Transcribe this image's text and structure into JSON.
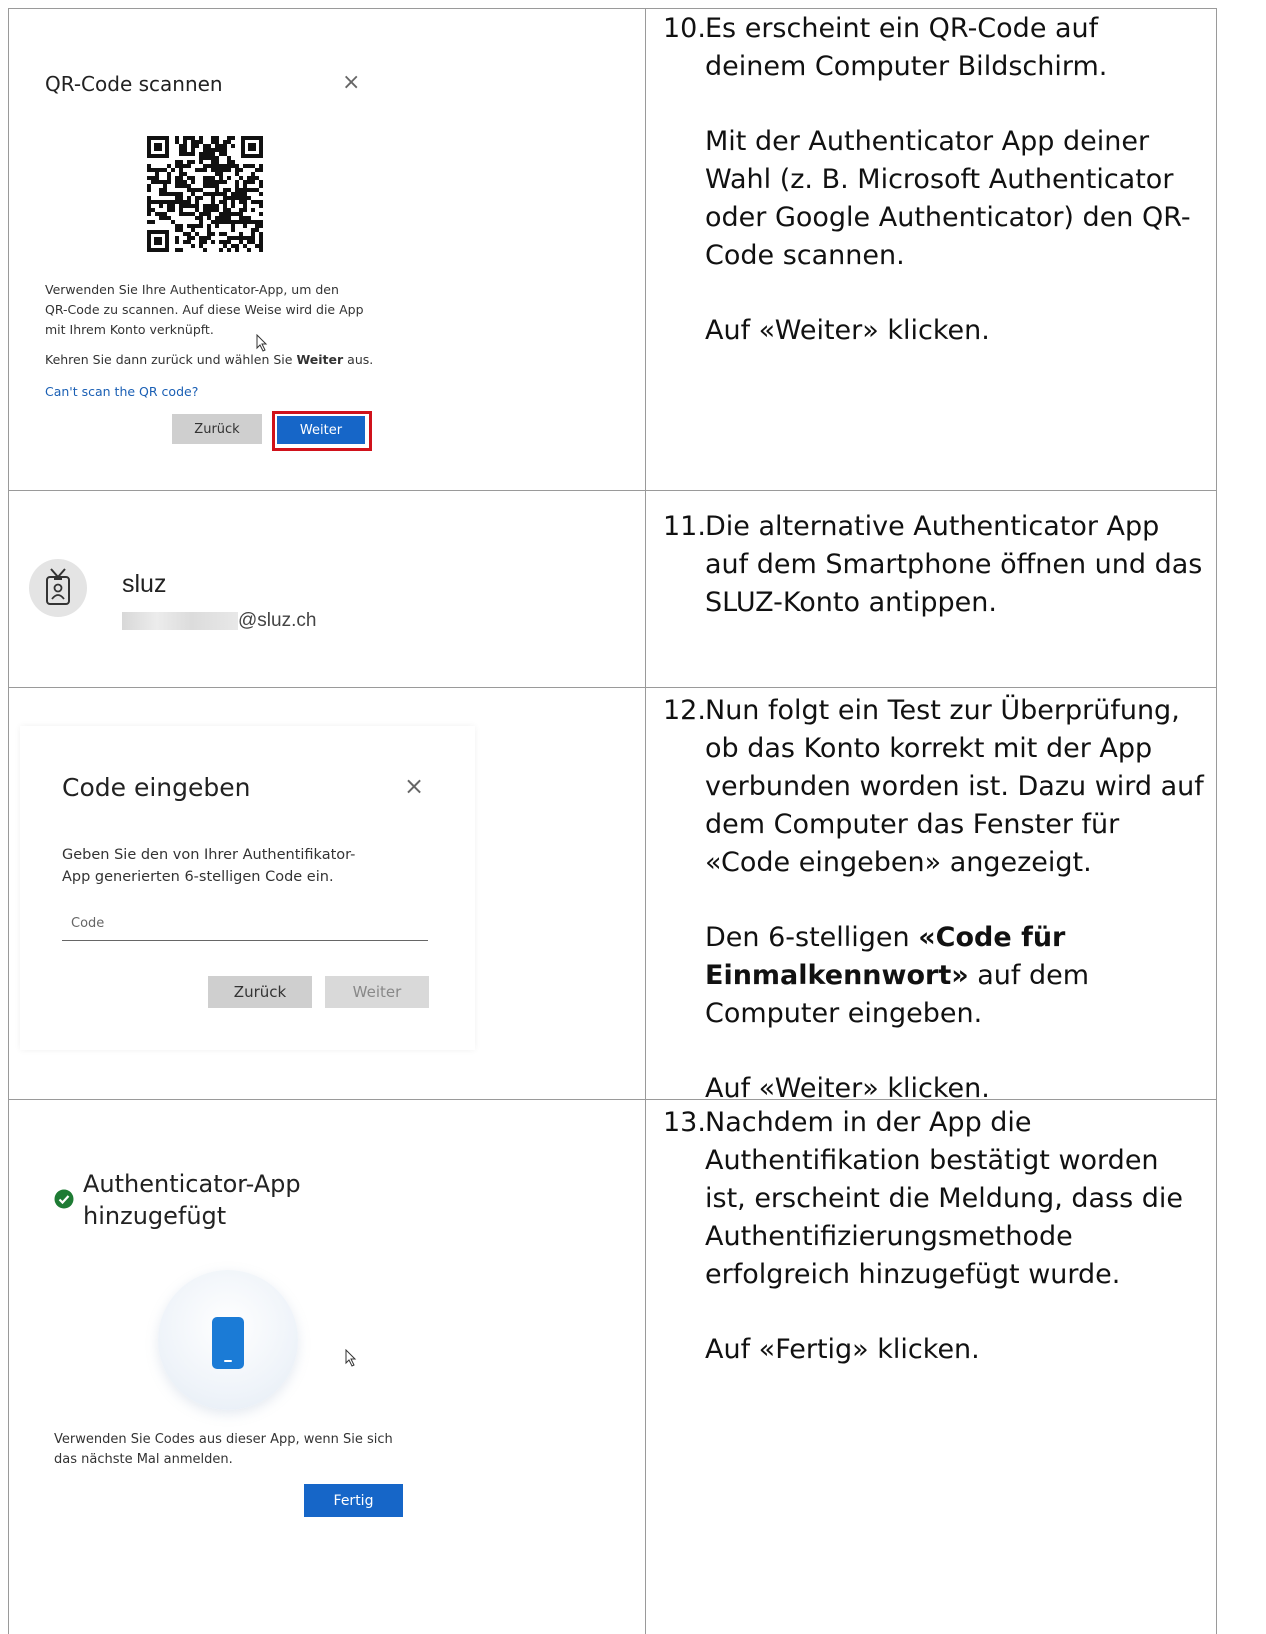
{
  "step10": {
    "number": "10.",
    "paragraphs": [
      "Es erscheint ein QR-Code auf deinem Computer Bildschirm.",
      "Mit der Authenticator App deiner Wahl (z. B. Microsoft Authenticator oder Google Authenticator) den QR-Code scannen.",
      "Auf «Weiter» klicken."
    ],
    "screen": {
      "title": "QR-Code scannen",
      "close": "×",
      "text1": "Verwenden Sie Ihre Authenticator-App, um den QR-Code zu scannen. Auf diese Weise wird die App mit Ihrem Konto verknüpft.",
      "text2_pre": "Kehren Sie dann zurück und wählen Sie ",
      "text2_bold": "Weiter",
      "text2_post": " aus.",
      "link": "Can't scan the QR code?",
      "back": "Zurück",
      "next": "Weiter"
    }
  },
  "step11": {
    "number": "11.",
    "paragraphs": [
      "Die alternative Authenticator App auf dem Smartphone öffnen und das SLUZ-Konto antippen."
    ],
    "screen": {
      "account_name": "sluz",
      "email_suffix": "@sluz.ch"
    }
  },
  "step12": {
    "number": "12.",
    "p1": "Nun folgt ein Test zur Überprüfung, ob das Konto korrekt mit der App verbunden worden ist. Dazu wird auf dem Computer das Fenster für «Code eingeben» angezeigt.",
    "p2_pre": "Den 6-stelligen ",
    "p2_bold": "«Code für Einmalkennwort»",
    "p2_post": " auf dem Computer eingeben.",
    "p3": "Auf «Weiter» klicken.",
    "screen": {
      "title": "Code eingeben",
      "close": "×",
      "text": "Geben Sie den von Ihrer Authentifikator-App generierten 6-stelligen Code ein.",
      "placeholder": "Code",
      "back": "Zurück",
      "next": "Weiter"
    }
  },
  "step13": {
    "number": "13.",
    "paragraphs": [
      "Nachdem in der App die Authentifikation bestätigt worden ist, erscheint die Meldung, dass die Authentifizierungsmethode erfolgreich hinzugefügt wurde.",
      "Auf «Fertig» klicken."
    ],
    "screen": {
      "title": "Authenticator-App hinzugefügt",
      "text": "Verwenden Sie Codes aus dieser App, wenn Sie sich das nächste Mal anmelden.",
      "done": "Fertig"
    }
  },
  "colors": {
    "primary_button": "#1666c8",
    "highlight_border": "#d0121b",
    "success_green": "#1e7b34",
    "link": "#1a5fb4"
  }
}
